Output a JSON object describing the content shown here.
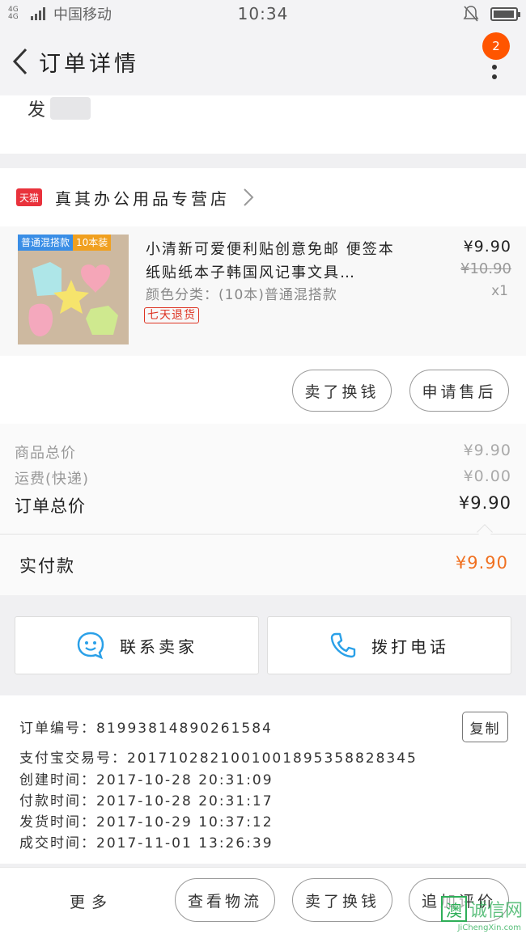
{
  "status_bar": {
    "network": "4G 4G",
    "carrier": "中国移动",
    "time": "10:34",
    "battery_level": 0.95
  },
  "nav": {
    "title": "订单详情",
    "badge_count": "2"
  },
  "address": {
    "partial_text": "发"
  },
  "shop": {
    "platform_badge": "天猫",
    "name": "真其办公用品专营店"
  },
  "item": {
    "thumb_tag_left": "普通混搭款",
    "thumb_tag_right": "10本装",
    "title": "小清新可爱便利贴创意免邮 便签本 纸贴纸本子韩国风记事文具…",
    "spec": "颜色分类：(10本)普通混搭款",
    "return_policy": "七天退货",
    "price": "¥9.90",
    "original_price": "¥10.90",
    "quantity": "x1",
    "actions": {
      "refund": "卖了换钱",
      "after_sale": "申请售后"
    }
  },
  "totals": {
    "goods_total_label": "商品总价",
    "goods_total": "¥9.90",
    "shipping_label": "运费(快递)",
    "shipping": "¥0.00",
    "order_total_label": "订单总价",
    "order_total": "¥9.90",
    "paid_label": "实付款",
    "paid": "¥9.90"
  },
  "contact": {
    "seller": "联系卖家",
    "phone": "拨打电话"
  },
  "info": {
    "order_no": "订单编号：81993814890261584",
    "copy": "复制",
    "alipay_no": "支付宝交易号：2017102821001001895358828345",
    "created": "创建时间：2017-10-28 20:31:09",
    "paid_time": "付款时间：2017-10-28 20:31:17",
    "shipped": "发货时间：2017-10-29 10:37:12",
    "completed": "成交时间：2017-11-01 13:26:39"
  },
  "bottom_bar": {
    "more": "更多",
    "logistics": "查看物流",
    "refund": "卖了换钱",
    "review": "追加评价"
  },
  "watermark": {
    "logo_char": "澳",
    "text": "诚信网",
    "url": "JiChengXin.com"
  },
  "colors": {
    "accent_orange": "#ff5500",
    "price_orange": "#f07020",
    "tmall_red": "#e9323c",
    "contact_blue": "#2aa0e8"
  }
}
